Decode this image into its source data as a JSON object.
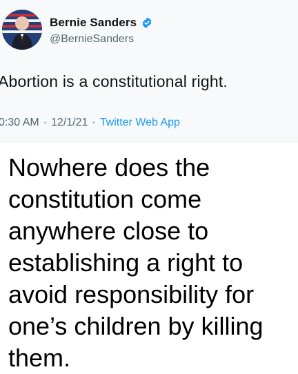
{
  "tweet": {
    "author": {
      "display_name": "Bernie Sanders",
      "handle": "@BernieSanders",
      "verified": true
    },
    "text": "Abortion is a constitutional right.",
    "time": "0:30 AM",
    "separator": "·",
    "date": "12/1/21",
    "source": "Twitter Web App"
  },
  "caption": {
    "text": "Nowhere does the constitution come anywhere close to establishing a right to avoid responsibility for one’s children by killing them."
  },
  "colors": {
    "link_blue": "#1d9bf0",
    "verified_blue": "#1d9bf0",
    "meta_gray": "#536471",
    "tweet_bg": "#f7f9fa"
  },
  "icons": {
    "verified": "verified-badge-icon",
    "avatar": "profile-avatar"
  }
}
